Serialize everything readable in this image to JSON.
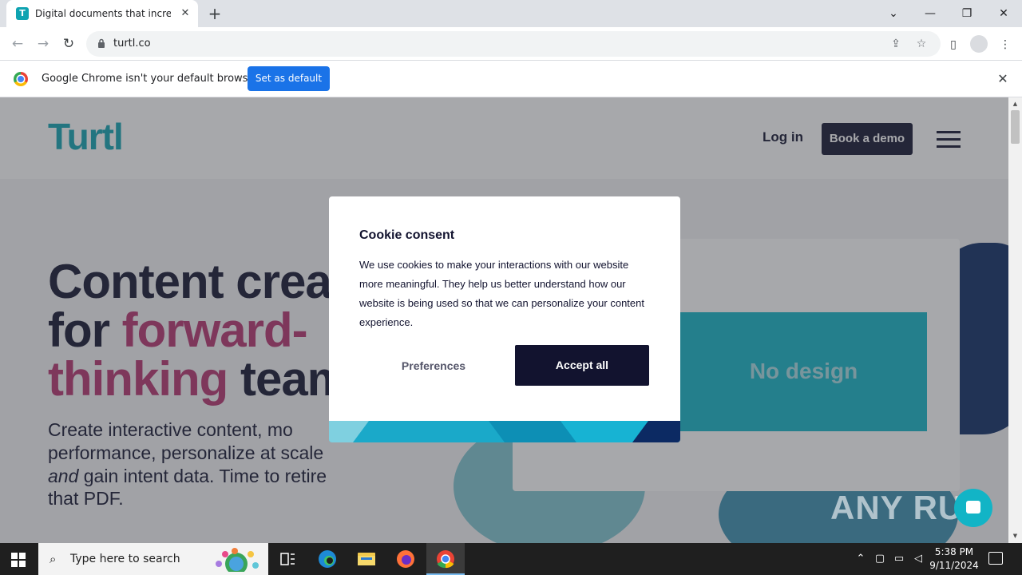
{
  "browser": {
    "tab_title": "Digital documents that increase",
    "tab_favicon_letter": "T",
    "url": "turtl.co",
    "infobar_text": "Google Chrome isn't your default browser",
    "set_default_label": "Set as default",
    "icons": {
      "close_tab": "close-icon",
      "new_tab": "plus-icon",
      "back": "arrow-left-icon",
      "forward": "arrow-right-icon",
      "reload": "reload-icon",
      "lock": "lock-icon",
      "share": "share-icon",
      "bookmark": "star-icon",
      "side_panel": "side-panel-icon",
      "profile": "profile-icon",
      "menu": "kebab-menu-icon"
    }
  },
  "site": {
    "logo": "Turtl",
    "login_label": "Log in",
    "demo_label": "Book a demo",
    "hero": {
      "h1_part1": "Content crea",
      "h1_part2": "for ",
      "h1_pink1": "forward-",
      "h1_pink2": "thinking",
      "h1_part3": " team",
      "paragraph_1": "Create interactive content, mo",
      "paragraph_2": "performance, personalize at scale",
      "paragraph_italic": "and",
      "paragraph_3": " gain intent data. Time to retire",
      "paragraph_4": "that PDF."
    },
    "card_text": "No design"
  },
  "cookie_modal": {
    "title": "Cookie consent",
    "body": "We use cookies to make your interactions with our website more meaningful. They help us better understand how our website is being used so that we can personalize your content experience.",
    "preferences_label": "Preferences",
    "accept_label": "Accept all"
  },
  "watermark": "ANY RUN",
  "taskbar": {
    "search_placeholder": "Type here to search",
    "time": "5:38 PM",
    "date": "9/11/2024"
  },
  "colors": {
    "brand_teal": "#0fa3b1",
    "brand_navy": "#12132f",
    "brand_pink": "#b5326e",
    "chrome_blue": "#1a73e8"
  }
}
